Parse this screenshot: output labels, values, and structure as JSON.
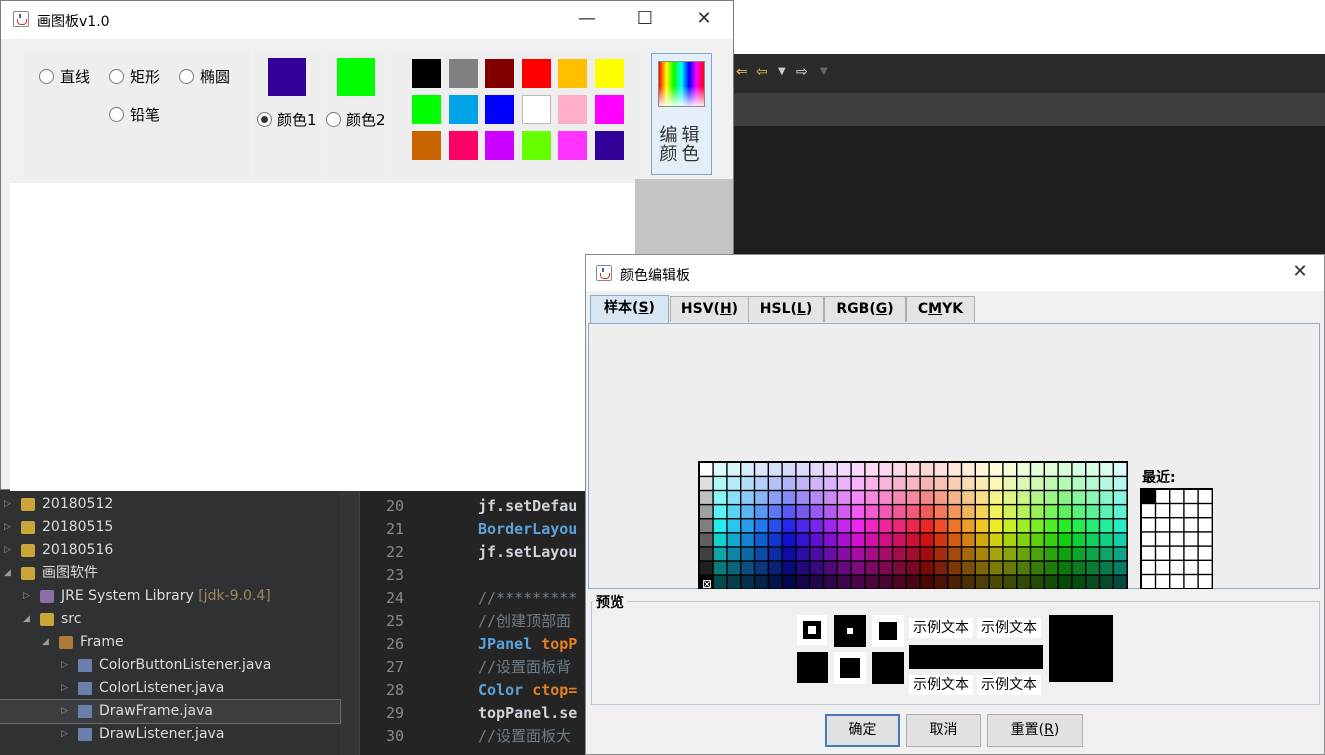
{
  "ide": {
    "explorer": [
      {
        "label": "20180512",
        "indent": 0,
        "twisty": "▷",
        "extra": ""
      },
      {
        "label": "20180515",
        "indent": 0,
        "twisty": "▷",
        "extra": ""
      },
      {
        "label": "20180516",
        "indent": 0,
        "twisty": "▷",
        "extra": ""
      },
      {
        "label": "画图软件",
        "indent": 0,
        "twisty": "◢",
        "extra": ""
      },
      {
        "label": "JRE System Library",
        "indent": 1,
        "twisty": "▷",
        "extra": "[jdk-9.0.4]"
      },
      {
        "label": "src",
        "indent": 1,
        "twisty": "◢",
        "extra": ""
      },
      {
        "label": "Frame",
        "indent": 2,
        "twisty": "◢",
        "extra": ""
      },
      {
        "label": "ColorButtonListener.java",
        "indent": 3,
        "twisty": "▷",
        "extra": ""
      },
      {
        "label": "ColorListener.java",
        "indent": 3,
        "twisty": "▷",
        "extra": ""
      },
      {
        "label": "DrawFrame.java",
        "indent": 3,
        "twisty": "▷",
        "extra": "",
        "selected": true
      },
      {
        "label": "DrawListener.java",
        "indent": 3,
        "twisty": "▷",
        "extra": ""
      }
    ],
    "code_lines": [
      {
        "num": "20",
        "a": "jf.setDefau",
        "kind": "plain"
      },
      {
        "num": "21",
        "a": "BorderLayou",
        "kind": "kw"
      },
      {
        "num": "22",
        "a": "jf.setLayou",
        "kind": "plain"
      },
      {
        "num": "23",
        "a": "",
        "kind": "plain"
      },
      {
        "num": "24",
        "a": "//*********",
        "kind": "cm"
      },
      {
        "num": "25",
        "a": "//创建顶部面",
        "kind": "cm"
      },
      {
        "num": "26",
        "a": "JPanel topP",
        "kind": "split",
        "b": "topP"
      },
      {
        "num": "27",
        "a": "//设置面板背",
        "kind": "cm"
      },
      {
        "num": "28",
        "a": "Color ctop=",
        "kind": "split",
        "b": "ctop="
      },
      {
        "num": "29",
        "a": "topPanel.se",
        "kind": "plain"
      },
      {
        "num": "30",
        "a": "//设置面板大",
        "kind": "cm"
      }
    ]
  },
  "main_window": {
    "title": "画图板v1.0",
    "controls": {
      "minimize": "—",
      "maximize": "☐",
      "close": "✕"
    },
    "shapes": [
      {
        "label": "直线",
        "checked": false
      },
      {
        "label": "矩形",
        "checked": false
      },
      {
        "label": "椭圆",
        "checked": false
      },
      {
        "label": "铅笔",
        "checked": false
      }
    ],
    "color_slots": [
      {
        "label": "颜色1",
        "color": "#330099",
        "checked": true
      },
      {
        "label": "颜色2",
        "color": "#00ff00",
        "checked": false
      }
    ],
    "palette": [
      "#000000",
      "#808080",
      "#800000",
      "#ff0000",
      "#ffc000",
      "#ffff00",
      "#00ff00",
      "#00a2e8",
      "#0000ff",
      "#ffffff",
      "#ffaec9",
      "#ff00ff",
      "#c86400",
      "#ff0066",
      "#cc00ff",
      "#66ff00",
      "#ff33ff",
      "#330099"
    ],
    "edit_color_label": "编辑颜色"
  },
  "dialog": {
    "title": "颜色编辑板",
    "close": "✕",
    "tabs": [
      {
        "pre": "样本(",
        "key": "S",
        "post": ")",
        "active": true
      },
      {
        "pre": "HSV(",
        "key": "H",
        "post": ")",
        "active": false
      },
      {
        "pre": "HSL(",
        "key": "L",
        "post": ")",
        "active": false
      },
      {
        "pre": "RGB(",
        "key": "G",
        "post": ")",
        "active": false
      },
      {
        "pre": "C",
        "key": "M",
        "post": "YK",
        "active": false
      }
    ],
    "recent_label": "最近:",
    "recent_colors": [
      "#000000"
    ],
    "preview_label": "预览",
    "sample_text": "示例文本",
    "preview_color": "#000000",
    "buttons": [
      {
        "pre": "确定",
        "key": "",
        "post": "",
        "default": true
      },
      {
        "pre": "取消",
        "key": "",
        "post": "",
        "default": false
      },
      {
        "pre": "重置(",
        "key": "R",
        "post": ")",
        "default": false
      }
    ]
  }
}
